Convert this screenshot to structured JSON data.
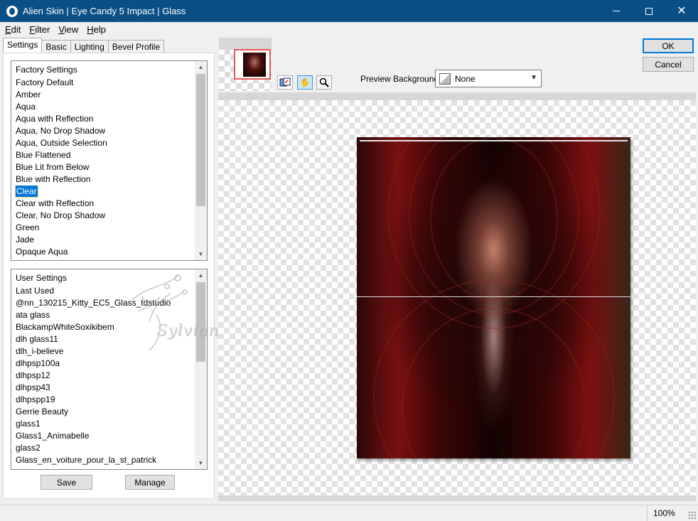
{
  "window": {
    "title": "Alien Skin | Eye Candy 5 Impact | Glass"
  },
  "menu": [
    {
      "accel": "E",
      "rest": "dit"
    },
    {
      "accel": "F",
      "rest": "ilter"
    },
    {
      "accel": "V",
      "rest": "iew"
    },
    {
      "accel": "H",
      "rest": "elp"
    }
  ],
  "tabs": [
    "Settings",
    "Basic",
    "Lighting",
    "Bevel Profile"
  ],
  "factory_settings": {
    "header": "Factory Settings",
    "items": [
      "Factory Default",
      "Amber",
      "Aqua",
      "Aqua with Reflection",
      "Aqua, No Drop Shadow",
      "Aqua, Outside Selection",
      "Blue Flattened",
      "Blue Lit from Below",
      "Blue with Reflection",
      "Clear",
      "Clear with Reflection",
      "Clear, No Drop Shadow",
      "Green",
      "Jade",
      "Opaque Aqua"
    ],
    "selected": "Clear"
  },
  "user_settings": {
    "header": "User Settings",
    "items": [
      "Last Used",
      "@nn_130215_Kitty_EC5_Glass_tdstudio",
      "ata glass",
      "BlackampWhiteSoxikibem",
      "dlh glass11",
      "dlh_i-believe",
      "dlhpsp100a",
      "dlhpsp12",
      "dlhpsp43",
      "dlhpspp19",
      "Gerrie Beauty",
      "glass1",
      "Glass1_Animabelle",
      "glass2",
      "Glass_en_voiture_pour_la_st_patrick"
    ]
  },
  "watermark": "Sylviane",
  "buttons": {
    "save": "Save",
    "manage": "Manage",
    "ok": "OK",
    "cancel": "Cancel"
  },
  "preview_background": {
    "label": "Preview Background:",
    "value": "None"
  },
  "status": {
    "zoom": "100%"
  }
}
